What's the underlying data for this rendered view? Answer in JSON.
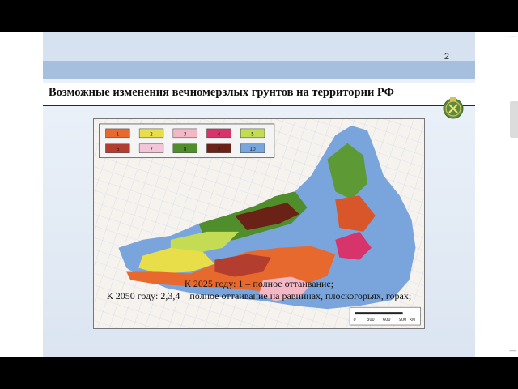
{
  "slide": {
    "number": "2",
    "title": "Возможные изменения вечномерзлых грунтов на территории РФ",
    "caption_line1": "К 2025 году: 1 – полное оттаивание;",
    "caption_line2": "К 2050 году:  2,3,4 – полное оттаивание на равнинах, плоскогорьях, горах;"
  },
  "map": {
    "legend": [
      {
        "label": "1",
        "color": "#e7692d"
      },
      {
        "label": "2",
        "color": "#e8de4a"
      },
      {
        "label": "3",
        "color": "#f3b7c6"
      },
      {
        "label": "4",
        "color": "#d6346a"
      },
      {
        "label": "5",
        "color": "#c3dc54"
      },
      {
        "label": "6",
        "color": "#b33d2e"
      },
      {
        "label": "7",
        "color": "#f1c6d7"
      },
      {
        "label": "8",
        "color": "#4f8e2a"
      },
      {
        "label": "9",
        "color": "#6a2116"
      },
      {
        "label": "10",
        "color": "#78a6de"
      }
    ],
    "scale_bar": {
      "ticks": [
        "0",
        "300",
        "600",
        "900"
      ],
      "unit": "км"
    }
  },
  "icons": {
    "emblem": "mining-emblem-icon"
  }
}
